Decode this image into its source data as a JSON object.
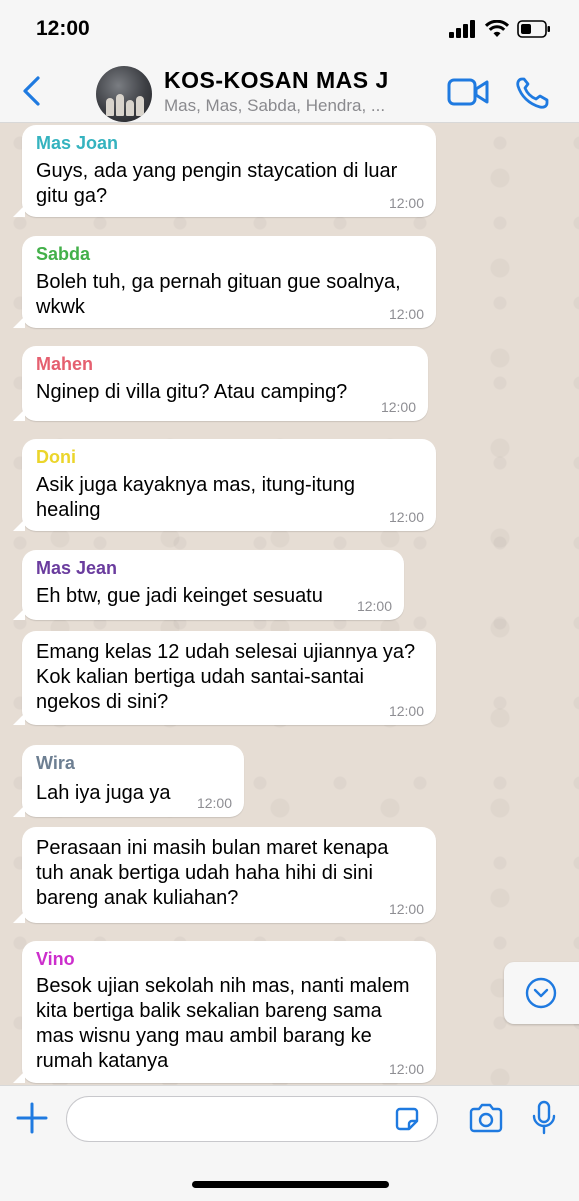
{
  "status_bar": {
    "time": "12:00"
  },
  "header": {
    "title": "KOS-KOSAN MAS J",
    "subtitle": "Mas, Mas, Sabda, Hendra, ...",
    "icons": [
      "back-chevron-icon",
      "video-camera-icon",
      "phone-icon"
    ],
    "accent_color": "#1f7ae0"
  },
  "messages": [
    {
      "sender": "Mas Joan",
      "sender_color": "#35b3bf",
      "lines": "Guys, ada yang pengin staycation di luar\ngitu ga?",
      "time": "12:00"
    },
    {
      "sender": "Sabda",
      "sender_color": "#43b04a",
      "lines": "Boleh tuh, ga pernah gituan gue soalnya,\nwkwk",
      "time": "12:00"
    },
    {
      "sender": "Mahen",
      "sender_color": "#e56070",
      "lines": "Nginep di villa gitu? Atau camping?",
      "time": "12:00"
    },
    {
      "sender": "Doni",
      "sender_color": "#ebd52b",
      "lines": "Asik juga kayaknya mas, itung-itung\nhealing",
      "time": "12:00"
    },
    {
      "sender": "Mas Jean",
      "sender_color": "#6a3c9e",
      "lines": "Eh btw, gue jadi keinget sesuatu",
      "time": "12:00"
    },
    {
      "sender": "",
      "sender_color": "",
      "lines": "Emang kelas 12 udah selesai ujiannya ya?\nKok kalian bertiga udah santai-santai\nngekos di sini?",
      "time": "12:00"
    },
    {
      "sender": "Wira",
      "sender_color": "#6d7f92",
      "lines": "Lah iya juga ya",
      "time": "12:00"
    },
    {
      "sender": "",
      "sender_color": "",
      "lines": "Perasaan ini masih bulan maret kenapa\ntuh anak bertiga udah haha hihi di sini\nbareng anak kuliahan?",
      "time": "12:00"
    },
    {
      "sender": "Vino",
      "sender_color": "#cc2ecc",
      "lines": "Besok ujian sekolah nih mas, nanti malem\nkita bertiga balik sekalian bareng sama\nmas wisnu yang mau ambil barang ke\nrumah katanya",
      "time": "12:00"
    }
  ],
  "composer": {
    "placeholder": "",
    "icons": [
      "plus-icon",
      "sticker-icon",
      "camera-icon",
      "microphone-icon"
    ]
  },
  "scroll_down_icon": "chevron-down-circle-icon"
}
